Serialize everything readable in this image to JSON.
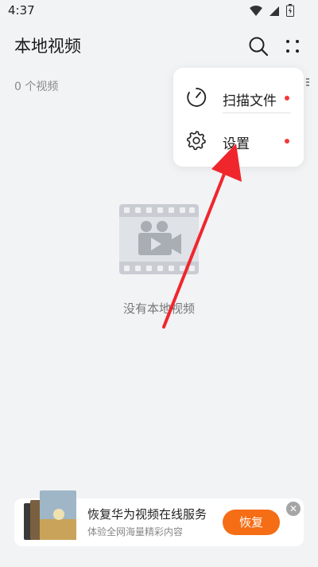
{
  "status_bar": {
    "time": "4:37",
    "icons": [
      "wifi-icon",
      "signal-icon",
      "battery-icon"
    ]
  },
  "header": {
    "title": "本地视频",
    "icons": [
      "search-icon",
      "more-icon"
    ]
  },
  "video_count": "0 个视频",
  "popup_menu": {
    "items": [
      {
        "label": "扫描文件",
        "icon": "scan-icon",
        "has_dot": true
      },
      {
        "label": "设置",
        "icon": "gear-icon",
        "has_dot": true
      }
    ],
    "dot_color": "#ef3b3b"
  },
  "empty_state": {
    "icon": "video-camera-film-icon",
    "text": "没有本地视频"
  },
  "annotation": {
    "arrow_color": "#f0262d"
  },
  "banner": {
    "title": "恢复华为视频在线服务",
    "subtitle": "体验全网海量精彩内容",
    "button_label": "恢复",
    "button_color": "#f56d14",
    "close_label": "✕"
  }
}
